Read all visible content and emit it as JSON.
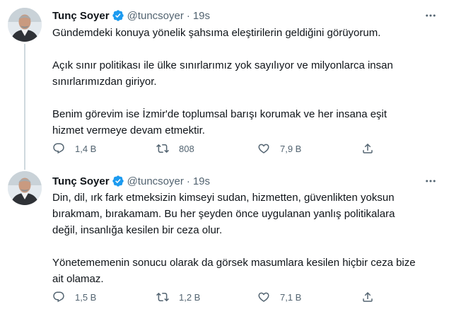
{
  "tweets": [
    {
      "author": {
        "name": "Tunç Soyer",
        "handle": "@tuncsoyer",
        "time": "19s"
      },
      "paragraphs": [
        [
          "Gündemdeki konuya yönelik şahsıma eleştirilerin geldiğini görüyorum."
        ],
        [
          "Açık sınır politikası ile ülke sınırlarımız yok sayılıyor ve milyonlarca insan",
          "sınırlarımızdan giriyor."
        ],
        [
          "Benim görevim ise İzmir'de toplumsal barışı korumak ve her insana eşit",
          "hizmet vermeye devam etmektir."
        ]
      ],
      "stats": {
        "replies": "1,4 B",
        "retweets": "808",
        "likes": "7,9 B"
      }
    },
    {
      "author": {
        "name": "Tunç Soyer",
        "handle": "@tuncsoyer",
        "time": "19s"
      },
      "paragraphs": [
        [
          "Din, dil, ırk fark etmeksizin kimseyi sudan, hizmetten, güvenlikten yoksun",
          "bırakmam, bırakamam. Bu her şeyden önce uygulanan yanlış politikalara",
          "değil, insanlığa kesilen bir ceza olur."
        ],
        [
          "Yönetememenin sonucu olarak da görsek masumlara kesilen hiçbir ceza bize",
          "ait olamaz."
        ]
      ],
      "stats": {
        "replies": "1,5 B",
        "retweets": "1,2 B",
        "likes": "7,1 B"
      }
    }
  ],
  "icons": {
    "verified": "verified-badge-icon",
    "more": "more-options-icon",
    "reply": "reply-icon",
    "retweet": "retweet-icon",
    "like": "heart-icon",
    "share": "share-icon"
  },
  "colors": {
    "text": "#0f1419",
    "secondary": "#536471",
    "verified": "#1d9bf0",
    "thread_line": "#cfd9de"
  },
  "separator": "·"
}
